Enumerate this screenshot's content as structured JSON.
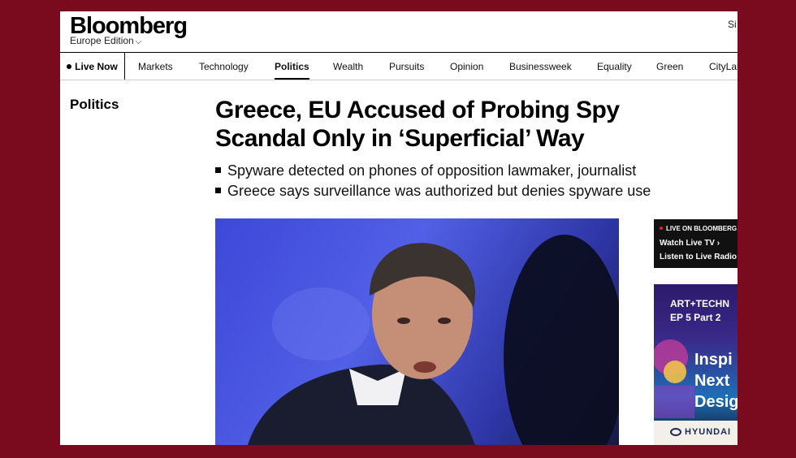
{
  "header": {
    "logo": "Bloomberg",
    "edition": "Europe Edition",
    "signin": "Si"
  },
  "nav": {
    "live_now": "Live Now",
    "items": [
      "Markets",
      "Technology",
      "Politics",
      "Wealth",
      "Pursuits",
      "Opinion",
      "Businessweek",
      "Equality",
      "Green",
      "CityLab"
    ],
    "active": "Politics"
  },
  "article": {
    "section": "Politics",
    "headline": "Greece, EU Accused of Probing Spy Scandal Only in ‘Superficial’ Way",
    "bullets": [
      "Spyware detected on phones of opposition lawmaker, journalist",
      "Greece says surveillance was authorized but denies spyware use"
    ]
  },
  "live_box": {
    "label": "LIVE ON BLOOMBERG",
    "watch": "Watch Live TV",
    "listen": "Listen to Live Radio"
  },
  "ad": {
    "line1": "ART+TECHN",
    "line2": "EP 5 Part 2",
    "big": "Inspi\nNext\nDesig",
    "brand": "HYUNDAI"
  }
}
